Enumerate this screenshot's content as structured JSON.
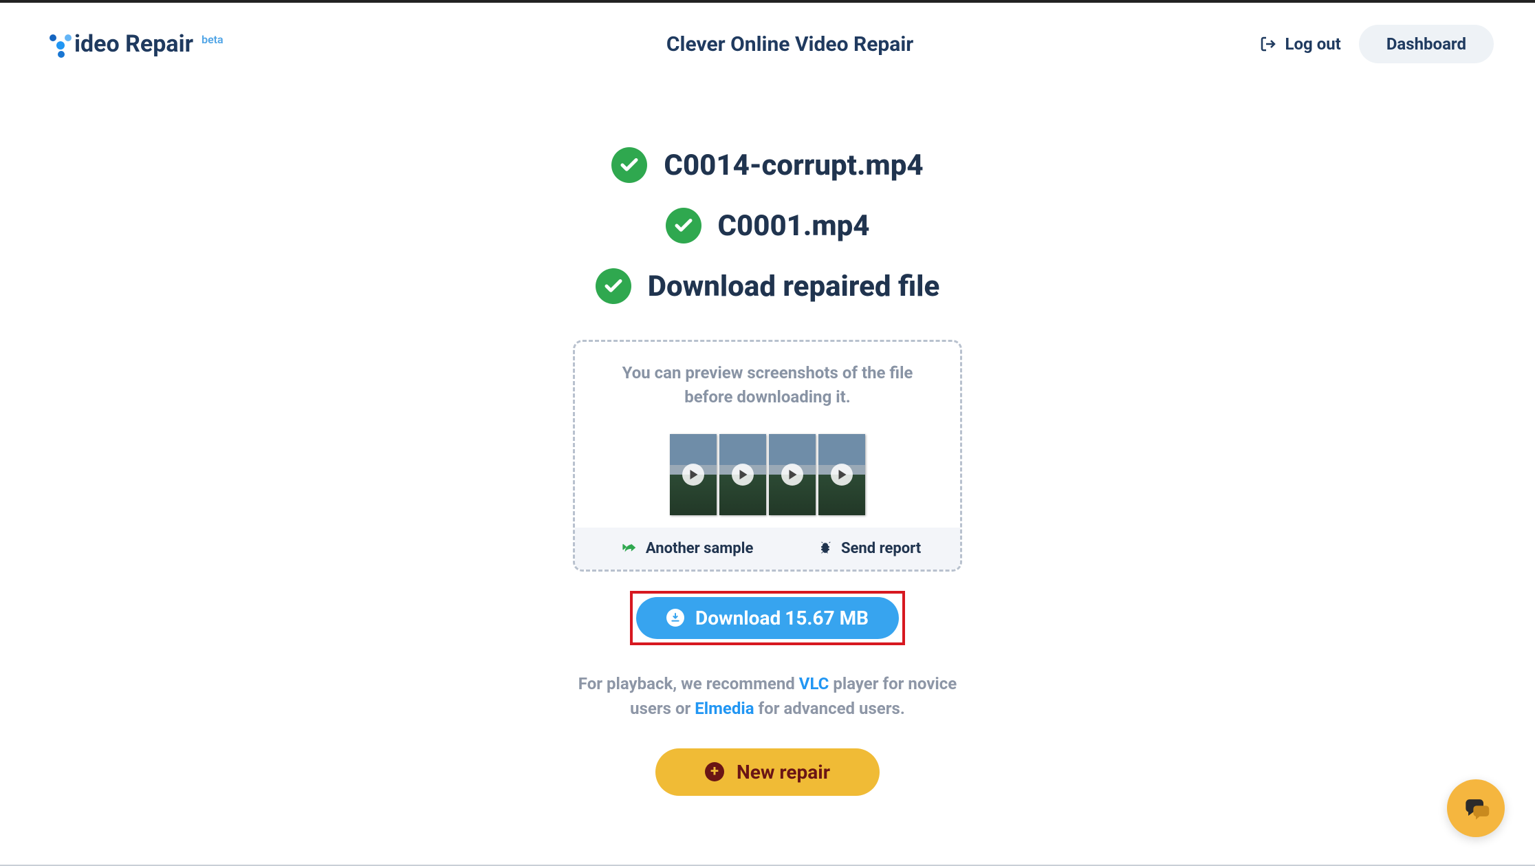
{
  "header": {
    "logo_text": "ideo Repair",
    "logo_badge": "beta",
    "title": "Clever Online Video Repair",
    "logout_label": "Log out",
    "dashboard_label": "Dashboard"
  },
  "steps": {
    "broken_file": "C0014-corrupt.mp4",
    "sample_file": "C0001.mp4",
    "download_label": "Download repaired file"
  },
  "preview": {
    "text": "You can preview screenshots of the file before downloading it.",
    "another_sample": "Another sample",
    "send_report": "Send report"
  },
  "download": {
    "label_prefix": "Download ",
    "file_size": "15.67 MB"
  },
  "recommendation": {
    "pre": "For playback, we recommend ",
    "vlc": "VLC",
    "mid": " player for novice users or ",
    "elmedia": "Elmedia",
    "post": " for advanced users."
  },
  "new_repair_label": "New repair"
}
